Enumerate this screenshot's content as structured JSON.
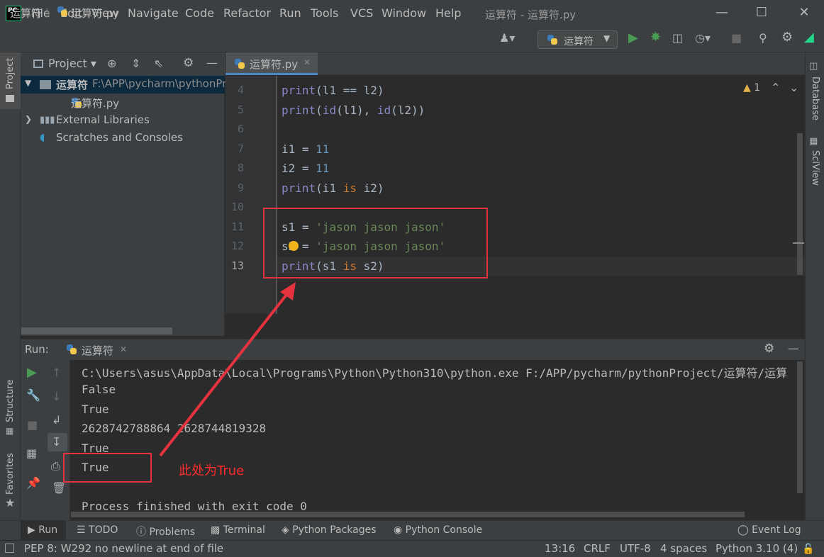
{
  "titlebar": {
    "logo": "PC",
    "menu": [
      "File",
      "Edit",
      "View",
      "Navigate",
      "Code",
      "Refactor",
      "Run",
      "Tools",
      "VCS",
      "Window",
      "Help"
    ],
    "window_title": "运算符 - 运算符.py",
    "buttons": [
      "minimize-icon",
      "maximize-icon",
      "close-icon"
    ]
  },
  "navbar": {
    "breadcrumb_root": "运算符",
    "breadcrumb_sep": "〉",
    "breadcrumb_file": "运算符.py",
    "run_config": "运算符"
  },
  "left_strip": {
    "project": "Project",
    "structure": "Structure",
    "favorites": "Favorites"
  },
  "right_strip": {
    "database": "Database",
    "sciview": "SciView"
  },
  "project_panel": {
    "title": "Project",
    "tree": {
      "root_name": "运算符",
      "root_path": "F:\\APP\\pycharm\\pythonPr",
      "file": "运算符.py",
      "external_libraries": "External Libraries",
      "scratches": "Scratches and Consoles"
    }
  },
  "editor": {
    "tab": "运算符.py",
    "inspection_count": "1",
    "line_numbers": [
      "4",
      "5",
      "6",
      "7",
      "8",
      "9",
      "10",
      "11",
      "12",
      "13"
    ],
    "lines": {
      "l4_fn": "print",
      "l4_rest": "(l1 == l2)",
      "l5_fn": "print",
      "l5_a": "(",
      "l5_id1": "id",
      "l5_b": "(l1), ",
      "l5_id2": "id",
      "l5_c": "(l2))",
      "l7_var": "i1 = ",
      "l7_num": "11",
      "l8_var": "i2 = ",
      "l8_num": "11",
      "l9_fn": "print",
      "l9_a": "(i1 ",
      "l9_kw": "is",
      "l9_b": " i2)",
      "l11_var": "s1 = ",
      "l11_str": "'jason jason jason'",
      "l12_var": "s2 = ",
      "l12_str": "'jason jason jason'",
      "l13_fn": "print",
      "l13_a": "(s1 ",
      "l13_kw": "is",
      "l13_b": " s2)"
    }
  },
  "run_panel": {
    "label": "Run:",
    "tab": "运算符",
    "output": [
      "C:\\Users\\asus\\AppData\\Local\\Programs\\Python\\Python310\\python.exe F:/APP/pycharm/pythonProject/运算符/运算",
      "False",
      "True",
      "2628742788864 2628744819328",
      "True",
      "True",
      "",
      "Process finished with exit code 0"
    ]
  },
  "annotation": {
    "text": "此处为True",
    "color": "#ff2c2c"
  },
  "bottom_tabs": [
    "Run",
    "TODO",
    "Problems",
    "Terminal",
    "Python Packages",
    "Python Console",
    "Event Log"
  ],
  "statusbar": {
    "message": "PEP 8: W292 no newline at end of file",
    "position": "13:16",
    "line_sep": "CRLF",
    "encoding": "UTF-8",
    "indent": "4 spaces",
    "interpreter": "Python 3.10 (4)"
  },
  "colors": {
    "accent_green": "#499c54",
    "keyword": "#cc7832",
    "string": "#6a8759",
    "number": "#6897bb",
    "builtin": "#8888c6"
  }
}
